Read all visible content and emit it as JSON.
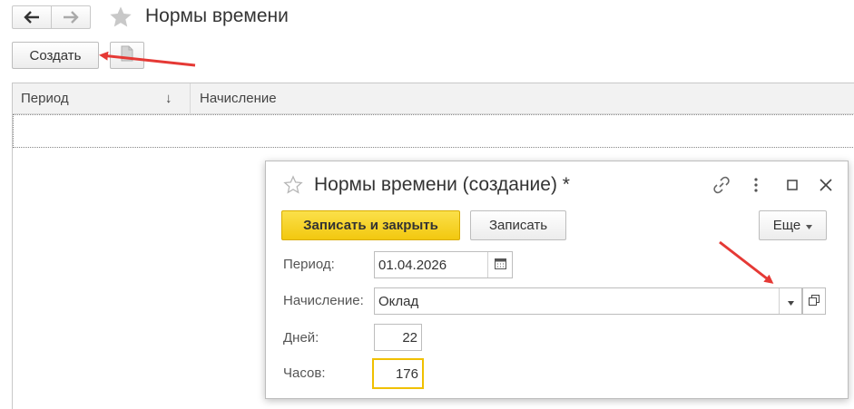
{
  "main": {
    "title": "Нормы времени",
    "create_label": "Создать",
    "columns": [
      "Период",
      "Начисление"
    ],
    "sort_indicator": "↓"
  },
  "dialog": {
    "title": "Нормы времени (создание) *",
    "save_close_label": "Записать и закрыть",
    "save_label": "Записать",
    "more_label": "Еще",
    "fields": {
      "period_label": "Период:",
      "period_value": "01.04.2026",
      "accrual_label": "Начисление:",
      "accrual_value": "Оклад",
      "days_label": "Дней:",
      "days_value": "22",
      "hours_label": "Часов:",
      "hours_value": "176"
    }
  },
  "icons": [
    "back-arrow-icon",
    "forward-arrow-icon",
    "star-icon",
    "copy-document-icon",
    "link-icon",
    "more-vertical-icon",
    "maximize-icon",
    "close-icon",
    "calendar-icon",
    "dropdown-arrow-icon",
    "open-form-icon",
    "red-annotation-arrow"
  ],
  "colors": {
    "primary_button": "#f5d21a",
    "highlight_border": "#f0c000",
    "annotation_red": "#e53935"
  }
}
